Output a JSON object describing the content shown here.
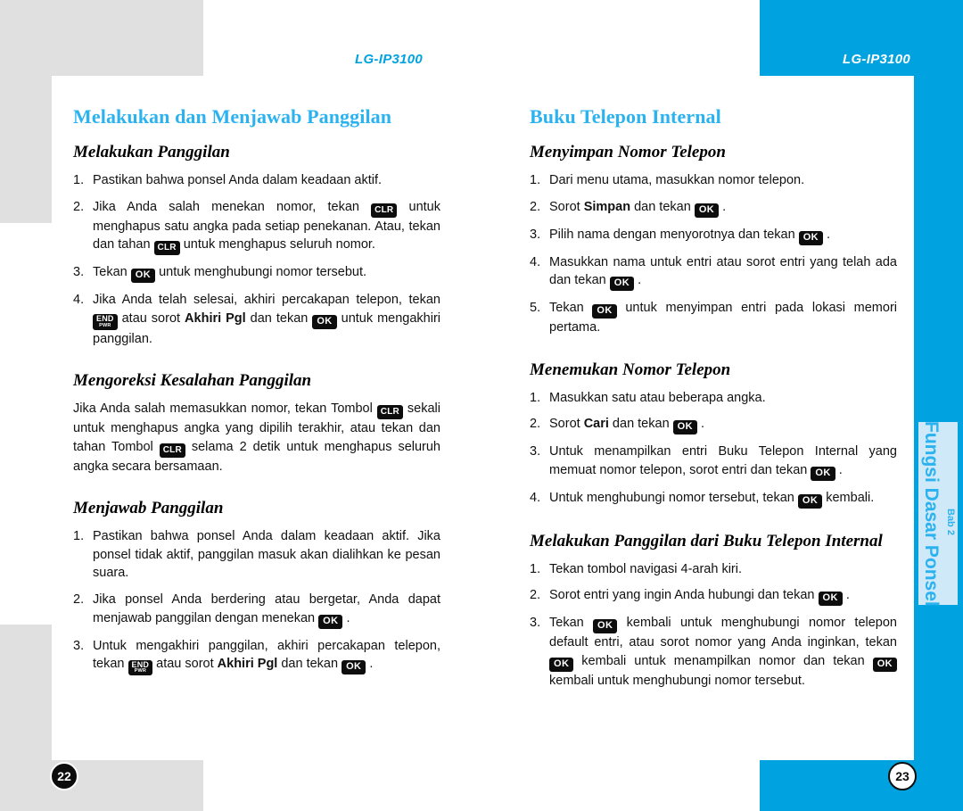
{
  "document": {
    "running_head_left": "LG-IP3100",
    "running_head_right": "LG-IP3100",
    "page_number_left": "22",
    "page_number_right": "23",
    "accent_blue": "#00a3e0",
    "title_blue": "#2cb3ef",
    "tab_blue": "#cfe9f9",
    "gray_block": "#e0e0e0"
  },
  "chapter_tab": {
    "title": "Fungsi Dasar Ponsel",
    "chapter": "Bab 2"
  },
  "keys": {
    "ok": "OK",
    "clr": "CLR",
    "end_top": "END",
    "end_bottom": "PWR"
  },
  "left_page": {
    "section_title": "Melakukan dan Menjawab Panggilan",
    "sub1": {
      "title": "Melakukan Panggilan",
      "steps": [
        {
          "num": "1.",
          "parts": [
            {
              "t": "text",
              "v": "Pastikan bahwa ponsel Anda dalam keadaan aktif."
            }
          ]
        },
        {
          "num": "2.",
          "parts": [
            {
              "t": "text",
              "v": "Jika Anda salah menekan nomor, tekan "
            },
            {
              "t": "key-clr",
              "v": "CLR"
            },
            {
              "t": "text",
              "v": " untuk menghapus satu angka pada setiap penekanan. Atau, tekan dan tahan "
            },
            {
              "t": "key-clr",
              "v": "CLR"
            },
            {
              "t": "text",
              "v": " untuk menghapus seluruh nomor."
            }
          ]
        },
        {
          "num": "3.",
          "parts": [
            {
              "t": "text",
              "v": "Tekan "
            },
            {
              "t": "key-ok",
              "v": "OK"
            },
            {
              "t": "text",
              "v": " untuk menghubungi nomor tersebut."
            }
          ]
        },
        {
          "num": "4.",
          "parts": [
            {
              "t": "text",
              "v": "Jika Anda telah selesai, akhiri percakapan telepon, tekan "
            },
            {
              "t": "key-end",
              "v": "END PWR"
            },
            {
              "t": "text",
              "v": " atau sorot "
            },
            {
              "t": "bold",
              "v": "Akhiri Pgl"
            },
            {
              "t": "text",
              "v": " dan tekan "
            },
            {
              "t": "key-ok",
              "v": "OK"
            },
            {
              "t": "text",
              "v": " untuk mengakhiri panggilan."
            }
          ]
        }
      ]
    },
    "sub2": {
      "title": "Mengoreksi Kesalahan Panggilan",
      "paragraph_parts": [
        {
          "t": "text",
          "v": "Jika Anda salah memasukkan nomor, tekan Tombol "
        },
        {
          "t": "key-clr",
          "v": "CLR"
        },
        {
          "t": "text",
          "v": " sekali untuk menghapus angka yang dipilih terakhir, atau tekan dan tahan Tombol "
        },
        {
          "t": "key-clr",
          "v": "CLR"
        },
        {
          "t": "text",
          "v": " selama 2 detik untuk menghapus seluruh angka secara bersamaan."
        }
      ]
    },
    "sub3": {
      "title": "Menjawab Panggilan",
      "steps": [
        {
          "num": "1.",
          "parts": [
            {
              "t": "text",
              "v": "Pastikan bahwa ponsel Anda dalam keadaan aktif. Jika ponsel tidak aktif, panggilan masuk akan dialihkan ke pesan suara."
            }
          ]
        },
        {
          "num": "2.",
          "parts": [
            {
              "t": "text",
              "v": "Jika ponsel Anda berdering atau bergetar, Anda dapat menjawab panggilan dengan menekan "
            },
            {
              "t": "key-ok",
              "v": "OK"
            },
            {
              "t": "text",
              "v": " ."
            }
          ]
        },
        {
          "num": "3.",
          "parts": [
            {
              "t": "text",
              "v": "Untuk mengakhiri panggilan, akhiri percakapan telepon, tekan "
            },
            {
              "t": "key-end",
              "v": "END PWR"
            },
            {
              "t": "text",
              "v": " atau sorot "
            },
            {
              "t": "bold",
              "v": "Akhiri Pgl"
            },
            {
              "t": "text",
              "v": " dan tekan "
            },
            {
              "t": "key-ok",
              "v": "OK"
            },
            {
              "t": "text",
              "v": " ."
            }
          ]
        }
      ]
    }
  },
  "right_page": {
    "section_title": "Buku Telepon Internal",
    "sub1": {
      "title": "Menyimpan Nomor Telepon",
      "steps": [
        {
          "num": "1.",
          "parts": [
            {
              "t": "text",
              "v": "Dari menu utama, masukkan nomor telepon."
            }
          ]
        },
        {
          "num": "2.",
          "parts": [
            {
              "t": "text",
              "v": "Sorot "
            },
            {
              "t": "bold",
              "v": "Simpan"
            },
            {
              "t": "text",
              "v": " dan tekan "
            },
            {
              "t": "key-ok",
              "v": "OK"
            },
            {
              "t": "text",
              "v": " ."
            }
          ]
        },
        {
          "num": "3.",
          "parts": [
            {
              "t": "text",
              "v": "Pilih nama dengan menyorotnya dan tekan "
            },
            {
              "t": "key-ok",
              "v": "OK"
            },
            {
              "t": "text",
              "v": " ."
            }
          ]
        },
        {
          "num": "4.",
          "parts": [
            {
              "t": "text",
              "v": "Masukkan nama untuk entri atau sorot entri yang telah ada dan tekan "
            },
            {
              "t": "key-ok",
              "v": "OK"
            },
            {
              "t": "text",
              "v": " ."
            }
          ]
        },
        {
          "num": "5.",
          "parts": [
            {
              "t": "text",
              "v": "Tekan "
            },
            {
              "t": "key-ok",
              "v": "OK"
            },
            {
              "t": "text",
              "v": " untuk menyimpan entri pada lokasi memori pertama."
            }
          ]
        }
      ]
    },
    "sub2": {
      "title": "Menemukan Nomor Telepon",
      "steps": [
        {
          "num": "1.",
          "parts": [
            {
              "t": "text",
              "v": "Masukkan satu atau beberapa angka."
            }
          ]
        },
        {
          "num": "2.",
          "parts": [
            {
              "t": "text",
              "v": "Sorot "
            },
            {
              "t": "bold",
              "v": "Cari"
            },
            {
              "t": "text",
              "v": " dan tekan "
            },
            {
              "t": "key-ok",
              "v": "OK"
            },
            {
              "t": "text",
              "v": " ."
            }
          ]
        },
        {
          "num": "3.",
          "parts": [
            {
              "t": "text",
              "v": "Untuk menampilkan entri Buku Telepon Internal yang memuat nomor telepon, sorot entri dan tekan "
            },
            {
              "t": "key-ok",
              "v": "OK"
            },
            {
              "t": "text",
              "v": " ."
            }
          ]
        },
        {
          "num": "4.",
          "parts": [
            {
              "t": "text",
              "v": "Untuk menghubungi nomor tersebut, tekan "
            },
            {
              "t": "key-ok",
              "v": "OK"
            },
            {
              "t": "text",
              "v": " kembali."
            }
          ]
        }
      ]
    },
    "sub3": {
      "title": "Melakukan Panggilan dari Buku Telepon Internal",
      "steps": [
        {
          "num": "1.",
          "parts": [
            {
              "t": "text",
              "v": "Tekan tombol navigasi 4-arah kiri."
            }
          ]
        },
        {
          "num": "2.",
          "parts": [
            {
              "t": "text",
              "v": "Sorot entri yang ingin Anda hubungi dan tekan "
            },
            {
              "t": "key-ok",
              "v": "OK"
            },
            {
              "t": "text",
              "v": " ."
            }
          ]
        },
        {
          "num": "3.",
          "parts": [
            {
              "t": "text",
              "v": "Tekan "
            },
            {
              "t": "key-ok",
              "v": "OK"
            },
            {
              "t": "text",
              "v": " kembali untuk menghubungi nomor telepon default entri, atau sorot nomor yang Anda inginkan, tekan "
            },
            {
              "t": "key-ok",
              "v": "OK"
            },
            {
              "t": "text",
              "v": " kembali untuk menampilkan nomor dan tekan "
            },
            {
              "t": "key-ok",
              "v": "OK"
            },
            {
              "t": "text",
              "v": " kembali untuk menghubungi nomor tersebut."
            }
          ]
        }
      ]
    }
  }
}
